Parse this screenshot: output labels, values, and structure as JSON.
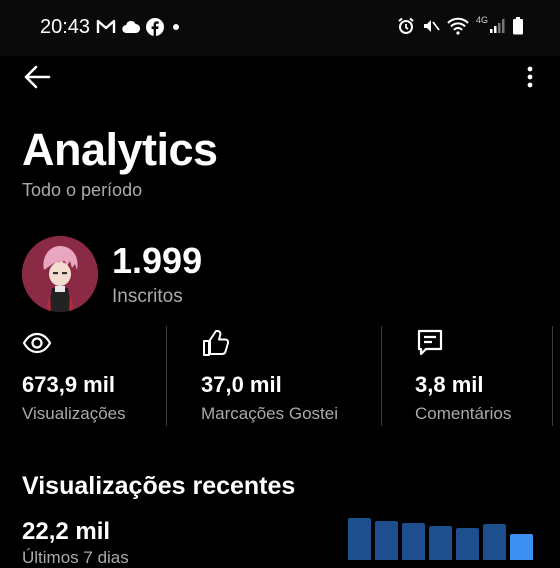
{
  "status_bar": {
    "time": "20:43",
    "network": "4G",
    "left_icons": [
      "gmail-icon",
      "cloud-icon",
      "facebook-icon",
      "dot-icon"
    ],
    "right_icons": [
      "alarm-icon",
      "mute-icon",
      "wifi-icon",
      "signal-icon",
      "battery-icon"
    ]
  },
  "app_bar": {
    "back_icon": "arrow-left-icon",
    "menu_icon": "more-vert-icon"
  },
  "header": {
    "title": "Analytics",
    "subtitle": "Todo o período"
  },
  "channel": {
    "subscribers": "1.999",
    "subscribers_label": "Inscritos"
  },
  "stats": [
    {
      "icon": "eye-icon",
      "value": "673,9 mil",
      "label": "Visualizações"
    },
    {
      "icon": "thumbs-up-icon",
      "value": "37,0 mil",
      "label": "Marcações Gostei"
    },
    {
      "icon": "comment-icon",
      "value": "3,8 mil",
      "label": "Comentários"
    }
  ],
  "recent": {
    "title": "Visualizações recentes",
    "value": "22,2 mil",
    "period": "Últimos 7 dias",
    "bar_levels": [
      0.95,
      0.88,
      0.85,
      0.78,
      0.72,
      0.82,
      0.6
    ],
    "bar_color": "#1d4f8f",
    "highlight_color": "#3d8ff2"
  },
  "colors": {
    "background": "#000000",
    "text": "#ffffff",
    "secondary_text": "#aaaaaa",
    "divider": "#3a3a3a"
  }
}
